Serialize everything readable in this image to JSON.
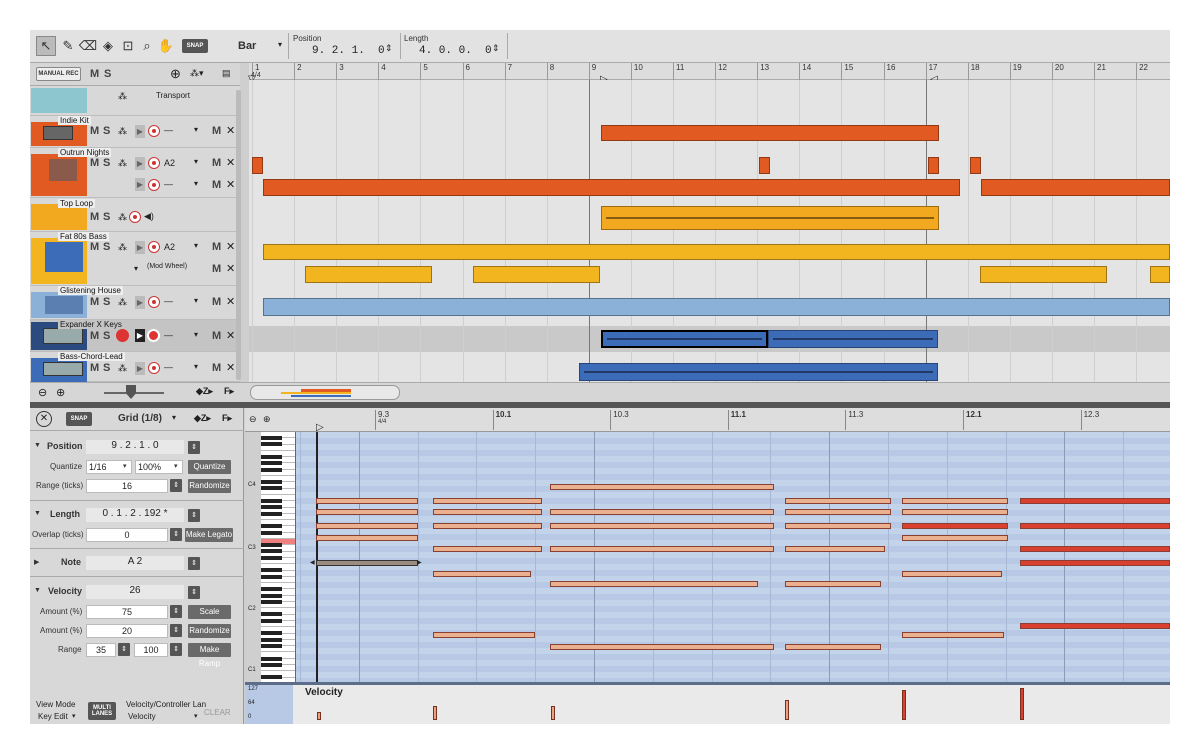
{
  "toolbar": {
    "snap": "SNAP",
    "quantize": "Bar",
    "position_label": "Position",
    "position_value": "9. 2. 1.  0",
    "length_label": "Length",
    "length_value": "4. 0. 0.  0"
  },
  "arrange_header": {
    "manual_rec": "MANUAL REC",
    "m": "M",
    "s": "S"
  },
  "ruler": [
    "1",
    "2",
    "3",
    "4",
    "5",
    "6",
    "7",
    "8",
    "9",
    "10",
    "11",
    "12",
    "13",
    "14",
    "15",
    "16",
    "17",
    "18",
    "19",
    "20",
    "21",
    "22"
  ],
  "ruler_sig": "4/4",
  "tracks": {
    "transport": "Transport",
    "indie_kit": "Indie Kit",
    "outrun": "Outrun Nights",
    "outrun_note": "A2",
    "outrun_dash": "—",
    "top_loop": "Top Loop",
    "fat_bass": "Fat 80s Bass",
    "fat_bass_note": "A2",
    "mod_wheel": "(Mod Wheel)",
    "glistening": "Glistening House",
    "expander": "Expander X Keys",
    "bass_chord": "Bass-Chord-Lead"
  },
  "inspector": {
    "snap": "SNAP",
    "grid": "Grid (1/8)",
    "position_label": "Position",
    "position_value": "9 . 2 . 1 . 0",
    "quantize_label": "Quantize",
    "quantize_value": "1/16",
    "quantize_pct": "100%",
    "quantize_btn": "Quantize",
    "range_label": "Range (ticks)",
    "range_value": "16",
    "randomize_btn": "Randomize",
    "length_label": "Length",
    "length_value": "0 . 1 . 2 . 192 *",
    "overlap_label": "Overlap (ticks)",
    "overlap_value": "0",
    "legato_btn": "Make Legato",
    "note_label": "Note",
    "note_value": "A 2",
    "velocity_label": "Velocity",
    "velocity_value": "26",
    "amount1_label": "Amount (%)",
    "amount1_value": "75",
    "scale_btn": "Scale",
    "amount2_label": "Amount (%)",
    "amount2_value": "20",
    "randomize2_btn": "Randomize",
    "range2_label": "Range",
    "range_lo": "35",
    "range_hi": "100",
    "ramp_btn": "Make Ramp",
    "view_mode_label": "View Mode",
    "view_mode_value": "Key Edit",
    "multi_lanes": "MULTI LANES",
    "lane_label": "Velocity/Controller Lan",
    "lane_value": "Velocity",
    "clear_btn": "CLEAR"
  },
  "piano_ruler": [
    {
      "t": "9.3",
      "sub": "4/4"
    },
    {
      "t": "10.1"
    },
    {
      "t": "10.3"
    },
    {
      "t": "11.1"
    },
    {
      "t": "11.3"
    },
    {
      "t": "12.1"
    },
    {
      "t": "12.3"
    }
  ],
  "keys": {
    "c4": "C4",
    "c3": "C3",
    "c2": "C2",
    "c1": "C1"
  },
  "velocity_lane": {
    "title": "Velocity",
    "v127": "127",
    "v64": "64",
    "v0": "0"
  },
  "colors": {
    "orange": "#e05a22",
    "yellow": "#f2b41f",
    "blue": "#3c6bb8",
    "note": "#ebb090",
    "note_red": "#d94030",
    "grid_bg": "#b7c9e4"
  }
}
